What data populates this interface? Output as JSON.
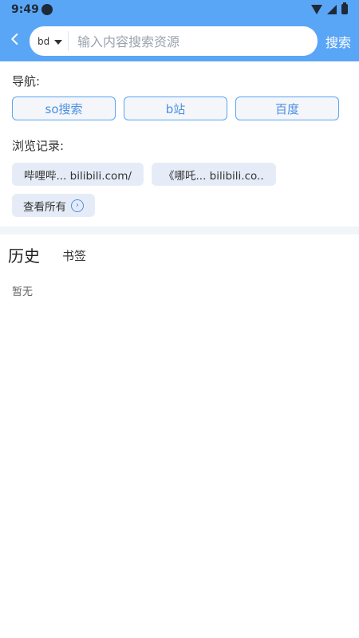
{
  "status": {
    "time": "9:49"
  },
  "header": {
    "engine_label": "bd",
    "search_placeholder": "输入内容搜索资源",
    "search_button_label": "搜索"
  },
  "navigation": {
    "title": "导航:",
    "items": [
      {
        "label": "so搜索"
      },
      {
        "label": "b站"
      },
      {
        "label": "百度"
      }
    ]
  },
  "browsing": {
    "title": "浏览记录:",
    "items": [
      {
        "label": "哔哩哔... bilibili.com/"
      },
      {
        "label": "《哪吒... bilibili.co.."
      }
    ],
    "view_all_label": "查看所有"
  },
  "tabs": {
    "history_label": "历史",
    "bookmarks_label": "书签"
  },
  "empty_state": {
    "label": "暂无"
  },
  "colors": {
    "primary": "#5aa6f6",
    "nav_text": "#4b8fe3",
    "chip_bg": "#e6ecf7",
    "band": "#f1f4f9"
  }
}
